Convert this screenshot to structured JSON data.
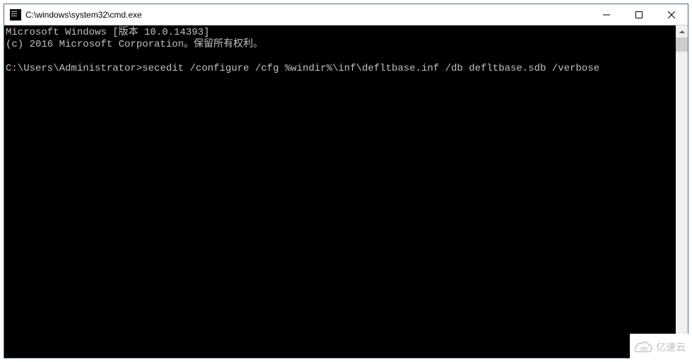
{
  "window": {
    "title": "C:\\windows\\system32\\cmd.exe"
  },
  "terminal": {
    "line1": "Microsoft Windows [版本 10.0.14393]",
    "line2": "(c) 2016 Microsoft Corporation。保留所有权利。",
    "prompt": "C:\\Users\\Administrator>",
    "command": "secedit /configure /cfg %windir%\\inf\\defltbase.inf /db defltbase.sdb /verbose"
  },
  "watermark": {
    "text": "亿速云"
  }
}
